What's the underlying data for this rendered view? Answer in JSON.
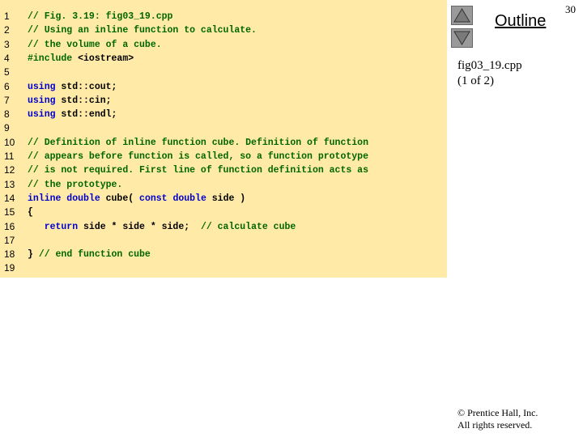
{
  "slide": {
    "page_number": "30",
    "outline_label": "Outline",
    "file_name": "fig03_19.cpp",
    "page_of": "(1 of 2)",
    "copyright_line1": "© Prentice Hall, Inc.",
    "copyright_line2": "All rights reserved."
  },
  "nav": {
    "up_icon": "triangle-up-icon",
    "down_icon": "triangle-down-icon"
  },
  "colors": {
    "panel_bg": "#ffeaa8",
    "comment": "#006600",
    "keyword": "#0000cc",
    "plain": "#000000"
  },
  "code": {
    "lines": [
      {
        "n": "1",
        "segs": [
          {
            "t": "c",
            "s": "// Fig. 3.19: fig03_19.cpp"
          }
        ]
      },
      {
        "n": "2",
        "segs": [
          {
            "t": "c",
            "s": "// Using an inline function to calculate."
          }
        ]
      },
      {
        "n": "3",
        "segs": [
          {
            "t": "c",
            "s": "// the volume of a cube."
          }
        ]
      },
      {
        "n": "4",
        "segs": [
          {
            "t": "c",
            "s": "#include "
          },
          {
            "t": "p",
            "s": "<iostream>"
          }
        ]
      },
      {
        "n": "5",
        "segs": []
      },
      {
        "n": "6",
        "segs": [
          {
            "t": "k",
            "s": "using "
          },
          {
            "t": "p",
            "s": "std::cout;"
          }
        ]
      },
      {
        "n": "7",
        "segs": [
          {
            "t": "k",
            "s": "using "
          },
          {
            "t": "p",
            "s": "std::cin;"
          }
        ]
      },
      {
        "n": "8",
        "segs": [
          {
            "t": "k",
            "s": "using "
          },
          {
            "t": "p",
            "s": "std::endl;"
          }
        ]
      },
      {
        "n": "9",
        "segs": []
      },
      {
        "n": "10",
        "segs": [
          {
            "t": "c",
            "s": "// Definition of inline function cube. Definition of function"
          }
        ]
      },
      {
        "n": "11",
        "segs": [
          {
            "t": "c",
            "s": "// appears before function is called, so a function prototype"
          }
        ]
      },
      {
        "n": "12",
        "segs": [
          {
            "t": "c",
            "s": "// is not required. First line of function definition acts as"
          }
        ]
      },
      {
        "n": "13",
        "segs": [
          {
            "t": "c",
            "s": "// the prototype."
          }
        ]
      },
      {
        "n": "14",
        "segs": [
          {
            "t": "k",
            "s": "inline double "
          },
          {
            "t": "p",
            "s": "cube( "
          },
          {
            "t": "k",
            "s": "const double "
          },
          {
            "t": "p",
            "s": "side )"
          }
        ]
      },
      {
        "n": "15",
        "segs": [
          {
            "t": "p",
            "s": "{"
          }
        ]
      },
      {
        "n": "16",
        "segs": [
          {
            "t": "k",
            "s": "   return "
          },
          {
            "t": "p",
            "s": "side * side * side;  "
          },
          {
            "t": "c",
            "s": "// calculate cube"
          }
        ]
      },
      {
        "n": "17",
        "segs": []
      },
      {
        "n": "18",
        "segs": [
          {
            "t": "p",
            "s": "} "
          },
          {
            "t": "c",
            "s": "// end function cube"
          }
        ]
      },
      {
        "n": "19",
        "segs": []
      }
    ]
  }
}
